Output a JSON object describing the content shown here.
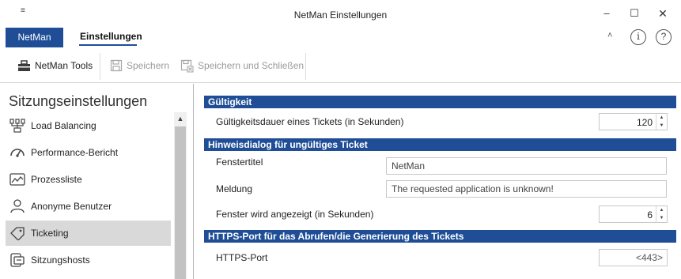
{
  "window": {
    "title": "NetMan Einstellungen",
    "quick_access": "≡",
    "minimize": "–",
    "maximize": "☐",
    "close": "✕"
  },
  "ribbon_tabs": {
    "file_label": "NetMan",
    "settings_label": "Einstellungen",
    "collapse": "˄",
    "info": "i",
    "help": "?"
  },
  "toolbar": {
    "tools_label": "NetMan Tools",
    "save_label": "Speichern",
    "save_close_label": "Speichern und Schließen"
  },
  "sidebar": {
    "title": "Sitzungseinstellungen",
    "scroll_up": "▲",
    "items": [
      {
        "label": "Load Balancing",
        "icon": "load-balancing-icon"
      },
      {
        "label": "Performance-Bericht",
        "icon": "gauge-icon"
      },
      {
        "label": "Prozessliste",
        "icon": "chart-window-icon"
      },
      {
        "label": "Anonyme Benutzer",
        "icon": "user-icon"
      },
      {
        "label": "Ticketing",
        "icon": "tag-icon",
        "active": true
      },
      {
        "label": "Sitzungshosts",
        "icon": "host-icon"
      }
    ]
  },
  "content": {
    "validity": {
      "header": "Gültigkeit",
      "duration_label": "Gültigkeitsdauer eines Tickets (in Sekunden)",
      "duration_value": "120"
    },
    "invalid_dialog": {
      "header": "Hinweisdialog für ungültiges Ticket",
      "window_title_label": "Fenstertitel",
      "window_title_value": "NetMan",
      "message_label": "Meldung",
      "message_value": "The requested application is unknown!",
      "display_time_label": "Fenster wird angezeigt (in Sekunden)",
      "display_time_value": "6"
    },
    "https": {
      "header": "HTTPS-Port für das Abrufen/die Generierung des Tickets",
      "port_label": "HTTPS-Port",
      "port_value": "<443>"
    },
    "spin_up": "▲",
    "spin_down": "▼"
  },
  "colors": {
    "accent": "#1f4e97",
    "active_item": "#d9d9d9",
    "disabled_text": "#9a9a9a"
  }
}
